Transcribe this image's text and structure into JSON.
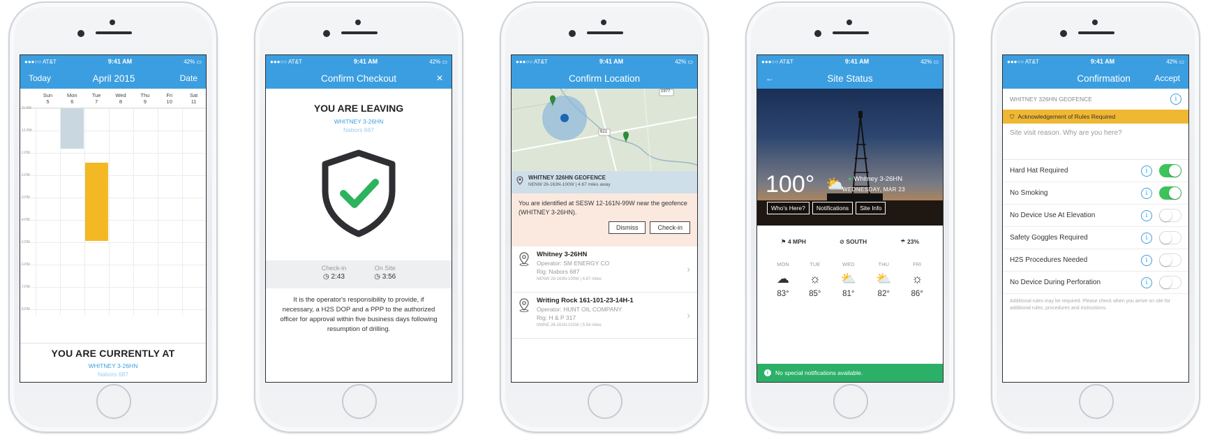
{
  "status": {
    "carrier": "●●●○○ AT&T",
    "wifi": "ᯤ",
    "time": "9:41 AM",
    "battery": "42%"
  },
  "screen1": {
    "nav": {
      "left": "Today",
      "title": "April 2015",
      "right": "Date"
    },
    "days": [
      {
        "d": "Sun",
        "n": "5"
      },
      {
        "d": "Mon",
        "n": "6"
      },
      {
        "d": "Tue",
        "n": "7"
      },
      {
        "d": "Wed",
        "n": "8"
      },
      {
        "d": "Thu",
        "n": "9"
      },
      {
        "d": "Fri",
        "n": "10"
      },
      {
        "d": "Sat",
        "n": "11"
      }
    ],
    "hours": [
      "11 AM",
      "12 PM",
      "1 PM",
      "2 PM",
      "3 PM",
      "4 PM",
      "5 PM",
      "6 PM",
      "7 PM",
      "8 PM"
    ],
    "current_title": "YOU ARE CURRENTLY AT",
    "current_site": "WHITNEY 3-26HN",
    "current_rig": "Nabors 687",
    "colors": {
      "past_event": "#c9d8e0",
      "active_event": "#f2b925"
    }
  },
  "screen2": {
    "nav_title": "Confirm Checkout",
    "close": "✕",
    "heading": "YOU ARE LEAVING",
    "site": "WHITNEY 3-26HN",
    "rig": "Nabors 687",
    "checkin_label": "Check-in",
    "checkin_value": "2:43",
    "onsite_label": "On Site",
    "onsite_value": "3:56",
    "responsibility": "It is the operator's responsibility to provide, if necessary, a H2S DOP and a PPP to the authorized officer for approval within five business days following resumption of drilling."
  },
  "screen3": {
    "nav_title": "Confirm Location",
    "map_labels": [
      "1977",
      "621"
    ],
    "geofence_title": "WHITNEY 326HN GEOFENCE",
    "geofence_sub": "NENW 26-163N-100W  |  4.67 miles away",
    "alert_text": "You are identified at SESW 12-161N-99W near the geofence (WHITNEY 3-26HN).",
    "dismiss": "Dismiss",
    "checkin": "Check-in",
    "locations": [
      {
        "name": "Whitney 3-26HN",
        "operator": "Operator: SM ENERGY CO",
        "rig": "Rig: Nabors 687",
        "meta": "NENW 26-163N-100W  |  4.67 miles"
      },
      {
        "name": "Writing Rock 161-101-23-14H-1",
        "operator": "Operator: HUNT OIL COMPANY",
        "rig": "Rig: H & P 317",
        "meta": "NWNE 26-161N-101W  |  5.54 miles"
      }
    ]
  },
  "screen4": {
    "nav_title": "Site Status",
    "back": "←",
    "temp": "100°",
    "site": "Whitney 3-26HN",
    "date": "WEDNESDAY, MAR 23",
    "buttons": [
      "Who's Here?",
      "Notifications",
      "Site Info"
    ],
    "wind_speed": "4 MPH",
    "wind_dir": "SOUTH",
    "precip": "23%",
    "forecast": [
      {
        "d": "MON",
        "icon": "cloud-icon",
        "t": "83°"
      },
      {
        "d": "TUE",
        "icon": "sun-icon",
        "t": "85°"
      },
      {
        "d": "WED",
        "icon": "partly-cloudy-icon",
        "t": "81°"
      },
      {
        "d": "THU",
        "icon": "partly-cloudy-icon",
        "t": "82°"
      },
      {
        "d": "FRI",
        "icon": "sun-icon",
        "t": "86°"
      }
    ],
    "notice": "No special notifications available."
  },
  "screen5": {
    "nav_title": "Confirmation",
    "nav_right": "Accept",
    "geofence": "WHITNEY 326HN GEOFENCE",
    "ack": "Acknowledgement of Rules Required",
    "reason_placeholder": "Site visit reason. Why are you here?",
    "rules": [
      {
        "label": "Hard Hat Required",
        "on": true
      },
      {
        "label": "No Smoking",
        "on": true
      },
      {
        "label": "No Device Use At Elevation",
        "on": false
      },
      {
        "label": "Safety Goggles Required",
        "on": false
      },
      {
        "label": "H2S Procedures Needed",
        "on": false
      },
      {
        "label": "No Device During Perforation",
        "on": false
      }
    ],
    "footnote": "Additional rules may be required. Please check when you arrive on site for additional rules, procedures and instructions."
  }
}
